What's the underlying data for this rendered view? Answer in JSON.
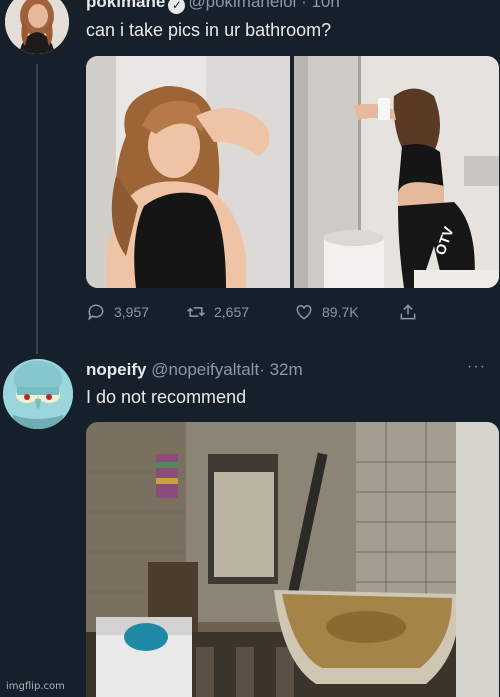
{
  "tweet1": {
    "display_name": "pokimane",
    "handle": "@pokimanelol",
    "time": "· 10h",
    "text": "can i take pics in ur bathroom?",
    "avatar_icon": "user-avatar-photo",
    "stats": {
      "replies": "3,957",
      "retweets": "2,657",
      "likes": "89.7K"
    }
  },
  "tweet2": {
    "display_name": "nopeify",
    "handle": "@nopeifyaltalt",
    "time": "· 32m",
    "text": "I do not recommend",
    "avatar_icon": "squidward-avatar"
  },
  "more_label": "···",
  "watermark": "imgflip.com",
  "colors": {
    "background": "#15202b",
    "text": "#e7e9ea",
    "muted": "#8b98a5"
  }
}
